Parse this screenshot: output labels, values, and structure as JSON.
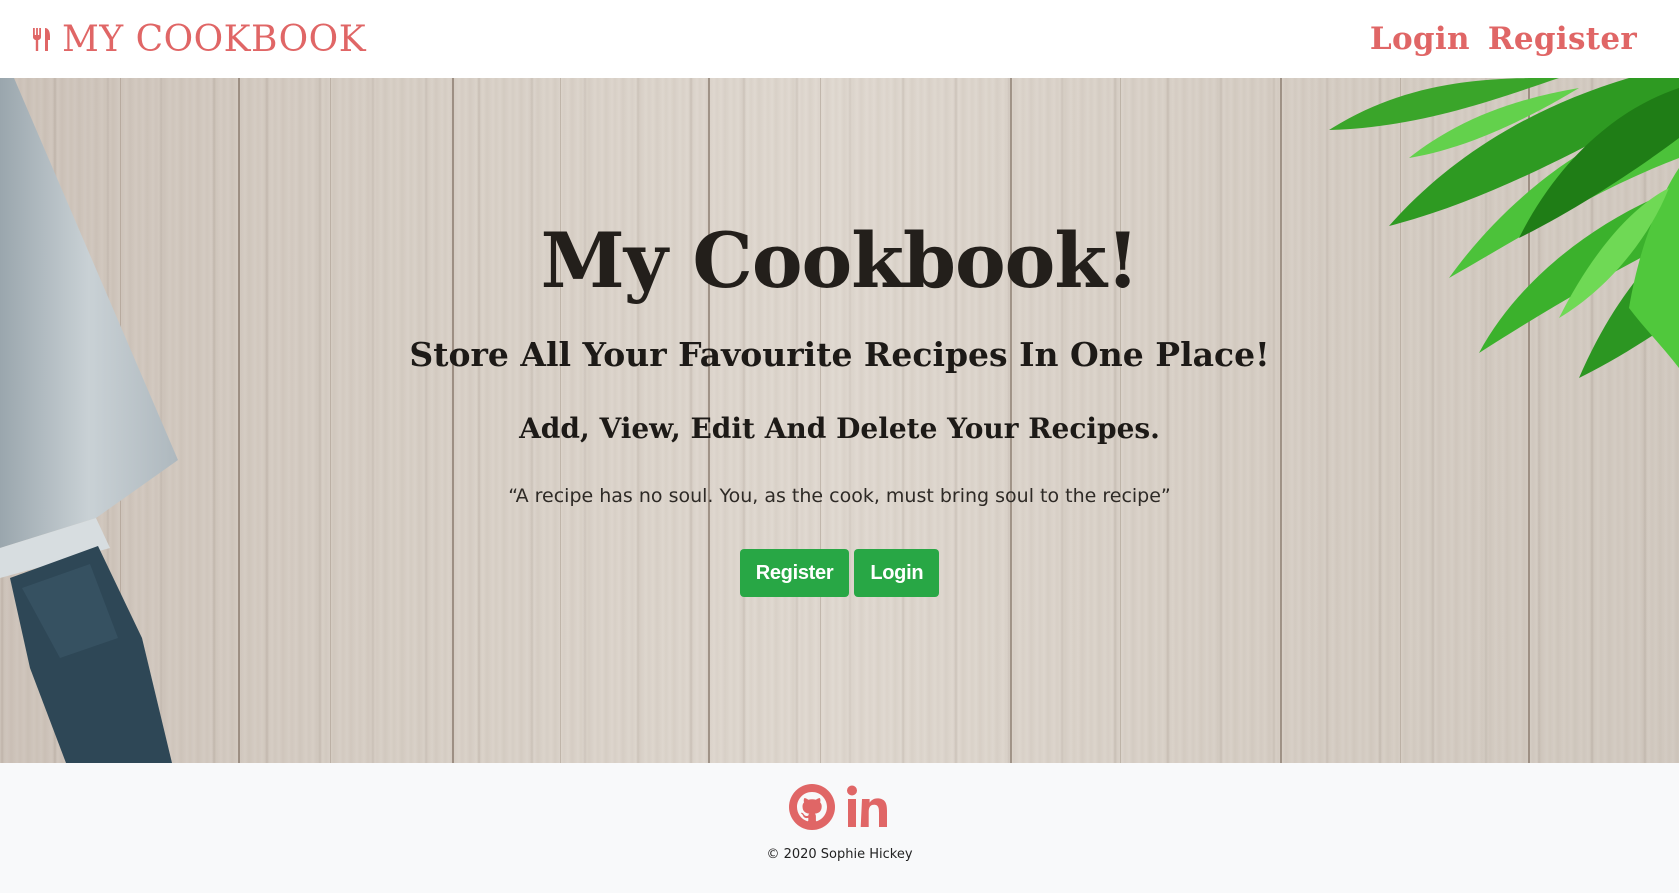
{
  "colors": {
    "accent": "#e06666",
    "button": "#28a745"
  },
  "navbar": {
    "brand_icon": "utensils-icon",
    "brand_text": "MY COOKBOOK",
    "links": [
      {
        "label": "Login"
      },
      {
        "label": "Register"
      }
    ]
  },
  "hero": {
    "title": "My Cookbook!",
    "subtitle": "Store All Your Favourite Recipes In One Place!",
    "subtitle2": "Add, View, Edit And Delete Your Recipes.",
    "quote": "“A recipe has no soul. You, as the cook, must bring soul to the recipe”",
    "buttons": {
      "register": "Register",
      "login": "Login"
    }
  },
  "footer": {
    "icons": [
      "github-icon",
      "linkedin-icon"
    ],
    "copyright": "© 2020 Sophie Hickey"
  }
}
